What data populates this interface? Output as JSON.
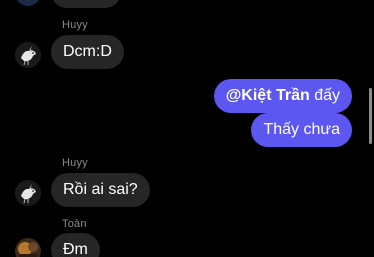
{
  "messages": {
    "m1": {
      "sender": "Huyy",
      "text": "Dcm:D"
    },
    "m2": {
      "mention": "@Kiệt Trần",
      "rest": " đấy"
    },
    "m3": {
      "text": "Thấy chưa"
    },
    "m4": {
      "sender": "Huyy",
      "text": "Rồi ai sai?"
    },
    "m5": {
      "sender": "Toàn",
      "text": "Đm"
    }
  },
  "colors": {
    "background": "#000000",
    "incoming_bubble": "#262626",
    "outgoing_bubble": "#5b57f0",
    "sender_name": "#8a8a8a"
  },
  "icons": {
    "avatar_huyy": "dove-avatar-icon",
    "avatar_toan": "profile-photo-avatar"
  }
}
